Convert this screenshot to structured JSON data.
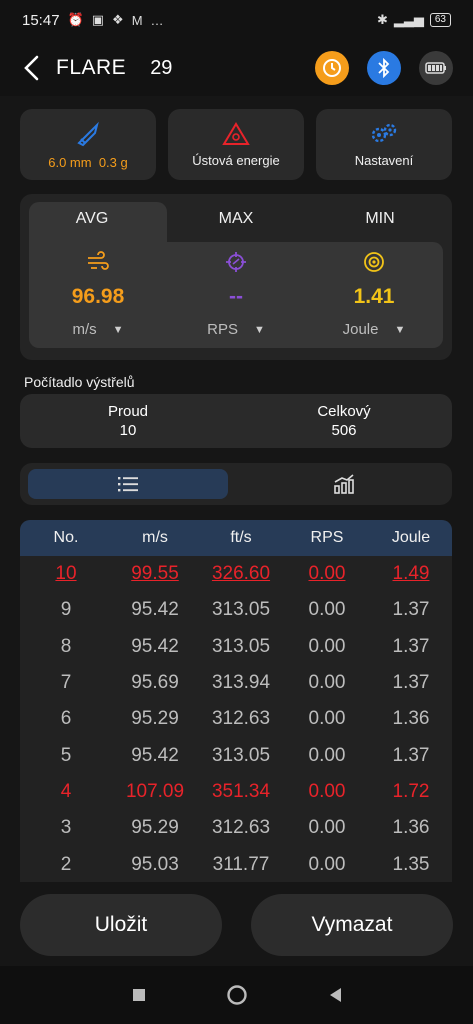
{
  "status_bar": {
    "time": "15:47",
    "battery": "63",
    "overflow": "…"
  },
  "header": {
    "title": "FLARE",
    "count": "29"
  },
  "tiles": {
    "ammo": {
      "caliber": "6.0 mm",
      "weight": "0.3 g"
    },
    "energy": {
      "label": "Ústová energie"
    },
    "settings": {
      "label": "Nastavení"
    }
  },
  "stats": {
    "tabs": [
      "AVG",
      "MAX",
      "MIN"
    ],
    "active_tab": "AVG",
    "speed": {
      "value": "96.98",
      "unit": "m/s"
    },
    "rps": {
      "value": "--",
      "unit": "RPS"
    },
    "energy": {
      "value": "1.41",
      "unit": "Joule"
    }
  },
  "counter": {
    "title": "Počítadlo výstřelů",
    "current_label": "Proud",
    "current_value": "10",
    "total_label": "Celkový",
    "total_value": "506"
  },
  "table": {
    "headers": [
      "No.",
      "m/s",
      "ft/s",
      "RPS",
      "Joule"
    ],
    "rows": [
      {
        "no": "10",
        "ms": "99.55",
        "fts": "326.60",
        "rps": "0.00",
        "joule": "1.49",
        "highlight": "max-underline"
      },
      {
        "no": "9",
        "ms": "95.42",
        "fts": "313.05",
        "rps": "0.00",
        "joule": "1.37",
        "highlight": ""
      },
      {
        "no": "8",
        "ms": "95.42",
        "fts": "313.05",
        "rps": "0.00",
        "joule": "1.37",
        "highlight": ""
      },
      {
        "no": "7",
        "ms": "95.69",
        "fts": "313.94",
        "rps": "0.00",
        "joule": "1.37",
        "highlight": ""
      },
      {
        "no": "6",
        "ms": "95.29",
        "fts": "312.63",
        "rps": "0.00",
        "joule": "1.36",
        "highlight": ""
      },
      {
        "no": "5",
        "ms": "95.42",
        "fts": "313.05",
        "rps": "0.00",
        "joule": "1.37",
        "highlight": ""
      },
      {
        "no": "4",
        "ms": "107.09",
        "fts": "351.34",
        "rps": "0.00",
        "joule": "1.72",
        "highlight": "red"
      },
      {
        "no": "3",
        "ms": "95.29",
        "fts": "312.63",
        "rps": "0.00",
        "joule": "1.36",
        "highlight": ""
      },
      {
        "no": "2",
        "ms": "95.03",
        "fts": "311.77",
        "rps": "0.00",
        "joule": "1.35",
        "highlight": ""
      }
    ]
  },
  "buttons": {
    "save": "Uložit",
    "clear": "Vymazat"
  },
  "colors": {
    "accent_orange": "#f59d1b",
    "accent_purple": "#8a4fd6",
    "accent_yellow": "#f2c418",
    "accent_blue": "#2a7ae2",
    "header_blue": "#273b57",
    "alert_red": "#e8232a"
  },
  "icons": [
    "back-arrow-icon",
    "timer-icon",
    "bluetooth-icon",
    "battery-icon",
    "bullet-icon",
    "warning-triangle-icon",
    "gears-icon",
    "wind-speed-icon",
    "target-icon",
    "energy-icon",
    "list-icon",
    "chart-icon"
  ]
}
